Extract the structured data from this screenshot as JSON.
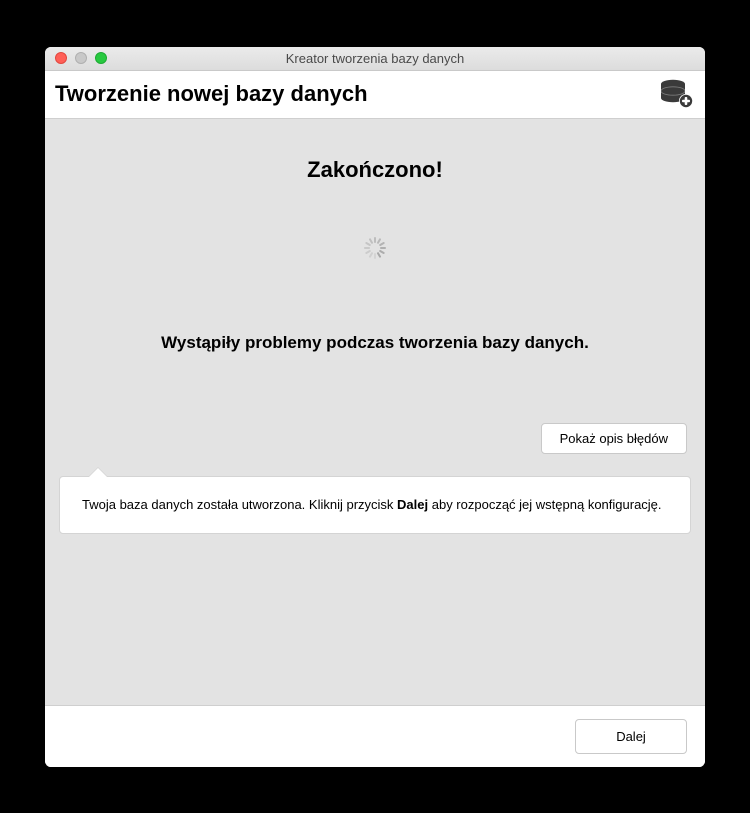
{
  "window": {
    "title": "Kreator tworzenia bazy danych"
  },
  "header": {
    "title": "Tworzenie nowej bazy danych",
    "icon": "database-add-icon"
  },
  "main": {
    "completed": "Zakończono!",
    "problem": "Wystąpiły problemy podczas tworzenia bazy danych.",
    "show_errors_label": "Pokaż opis błędów",
    "callout_prefix": "Twoja baza danych została utworzona. Kliknij przycisk ",
    "callout_bold": "Dalej",
    "callout_suffix": " aby rozpocząć jej wstępną konfigurację."
  },
  "footer": {
    "next_label": "Dalej"
  }
}
